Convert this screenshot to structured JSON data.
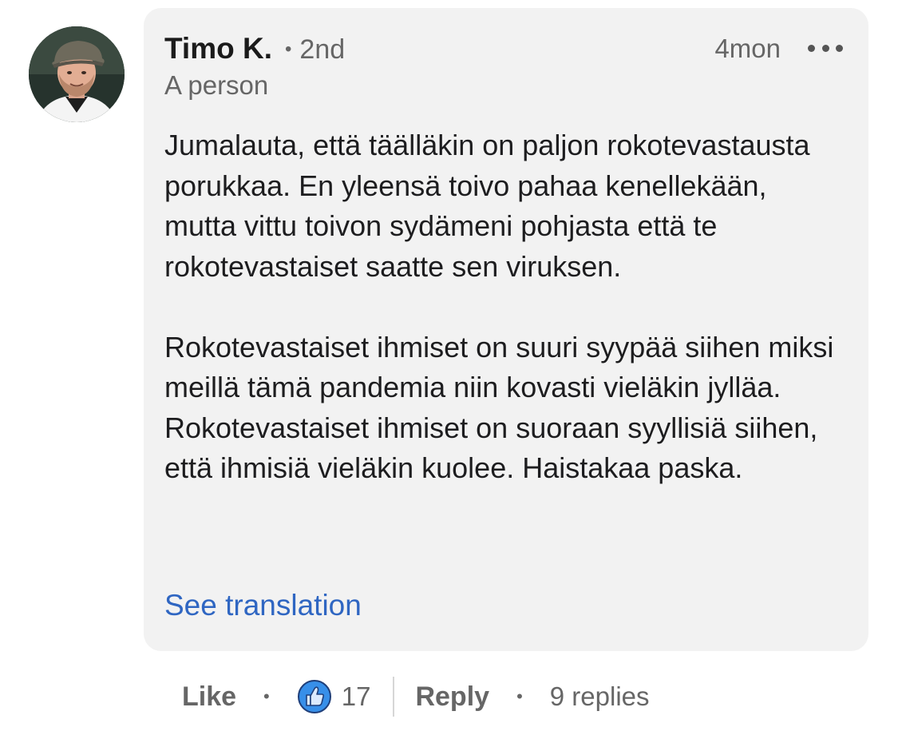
{
  "comment": {
    "author_name": "Timo K.",
    "degree_separator": "•",
    "connection_degree": "2nd",
    "headline": "A person",
    "timestamp": "4mon",
    "more_icon": "ellipsis-icon",
    "avatar_icon": "profile-photo",
    "paragraphs": [
      "Jumalauta, että täälläkin on paljon rokotevastausta porukkaa. En yleensä toivo pahaa kenellekään, mutta vittu toivon sydämeni pohjasta että te rokotevastaiset saatte sen viruksen.",
      "Rokotevastaiset ihmiset on suuri syypää siihen miksi meillä tämä pandemia niin kovasti vieläkin jylläa. Rokotevastaiset ihmiset on suoraan syyllisiä siihen, että ihmisiä vieläkin kuolee. Haistakaa paska."
    ],
    "see_translation": "See translation"
  },
  "actions": {
    "like_label": "Like",
    "dot": "•",
    "reaction_icon": "thumbs-up-icon",
    "reaction_count": "17",
    "reply_label": "Reply",
    "replies_label": "9 replies"
  },
  "colors": {
    "bubble_background": "#f2f2f2",
    "link_blue": "#2f66c2",
    "muted_text": "#666666",
    "like_blue": "#378fe9"
  }
}
